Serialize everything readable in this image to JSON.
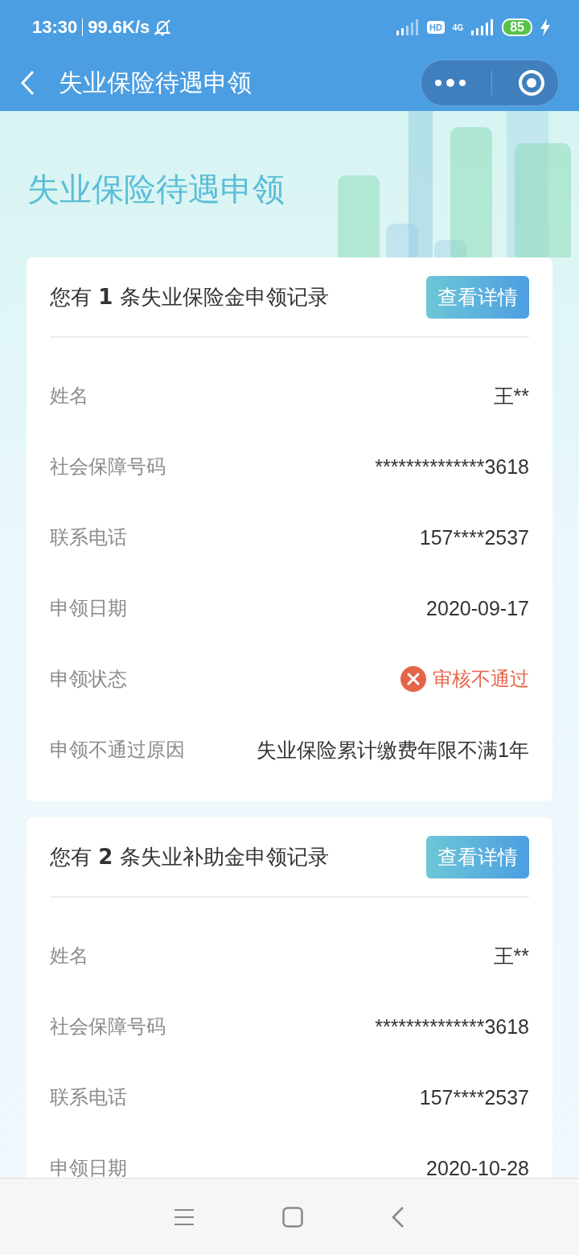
{
  "status_bar": {
    "time": "13:30",
    "speed": "99.6K/s",
    "hd": "HD",
    "network": "4G",
    "battery": "85"
  },
  "nav_bar": {
    "title": "失业保险待遇申领"
  },
  "hero": {
    "title": "失业保险待遇申领"
  },
  "cards": [
    {
      "title": "您有 **1** 条失业保险金申领记录",
      "button": "查看详情",
      "rows": [
        {
          "kind": "text",
          "label": "姓名",
          "value": "王**"
        },
        {
          "kind": "text",
          "label": "社会保障号码",
          "value": "**************3618"
        },
        {
          "kind": "text",
          "label": "联系电话",
          "value": "157****2537"
        },
        {
          "kind": "text",
          "label": "申领日期",
          "value": "2020-09-17"
        },
        {
          "kind": "status",
          "label": "申领状态",
          "value": "审核不通过"
        },
        {
          "kind": "text",
          "label": "申领不通过原因",
          "value": "失业保险累计缴费年限不满1年"
        }
      ]
    },
    {
      "title": "您有 **2** 条失业补助金申领记录",
      "button": "查看详情",
      "rows": [
        {
          "kind": "text",
          "label": "姓名",
          "value": "王**"
        },
        {
          "kind": "text",
          "label": "社会保障号码",
          "value": "**************3618"
        },
        {
          "kind": "text",
          "label": "联系电话",
          "value": "157****2537"
        },
        {
          "kind": "text",
          "label": "申领日期",
          "value": "2020-10-28"
        }
      ]
    }
  ]
}
